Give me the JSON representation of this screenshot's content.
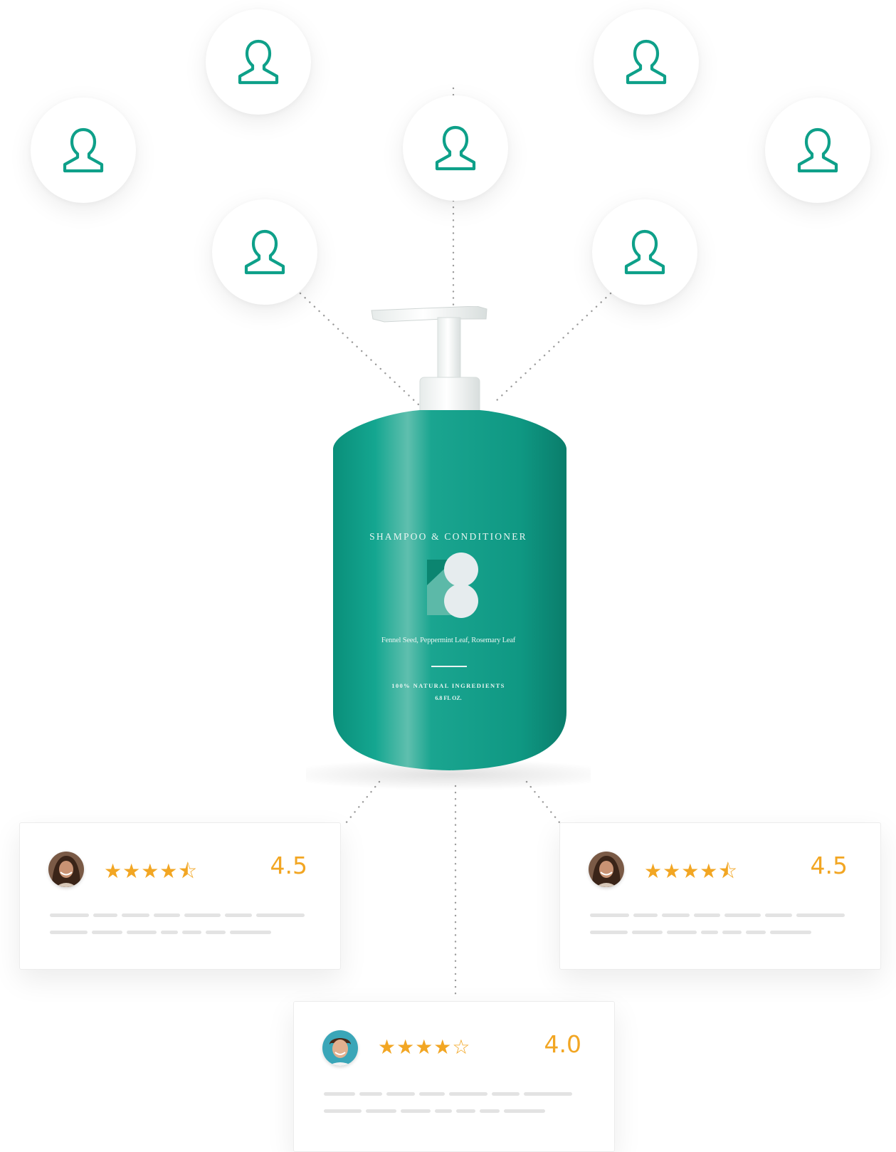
{
  "icon": "user-outline-icon",
  "brand_color": "#0ea089",
  "user_bubbles": [
    "user-outline-icon",
    "user-outline-icon",
    "user-outline-icon",
    "user-outline-icon",
    "user-outline-icon",
    "user-outline-icon",
    "user-outline-icon"
  ],
  "product": {
    "title": "SHAMPOO & CONDITIONER",
    "ingredients": "Fennel Seed, Peppermint Leaf, Rosemary Leaf",
    "tagline": "100% NATURAL INGREDIENTS",
    "volume": "6.8 FL OZ."
  },
  "reviews": [
    {
      "stars": "★★★★⯪",
      "rating": "4.5"
    },
    {
      "stars": "★★★★⯪",
      "rating": "4.5"
    },
    {
      "stars": "★★★★☆",
      "rating": "4.0"
    }
  ],
  "star_color": "#f2a623"
}
